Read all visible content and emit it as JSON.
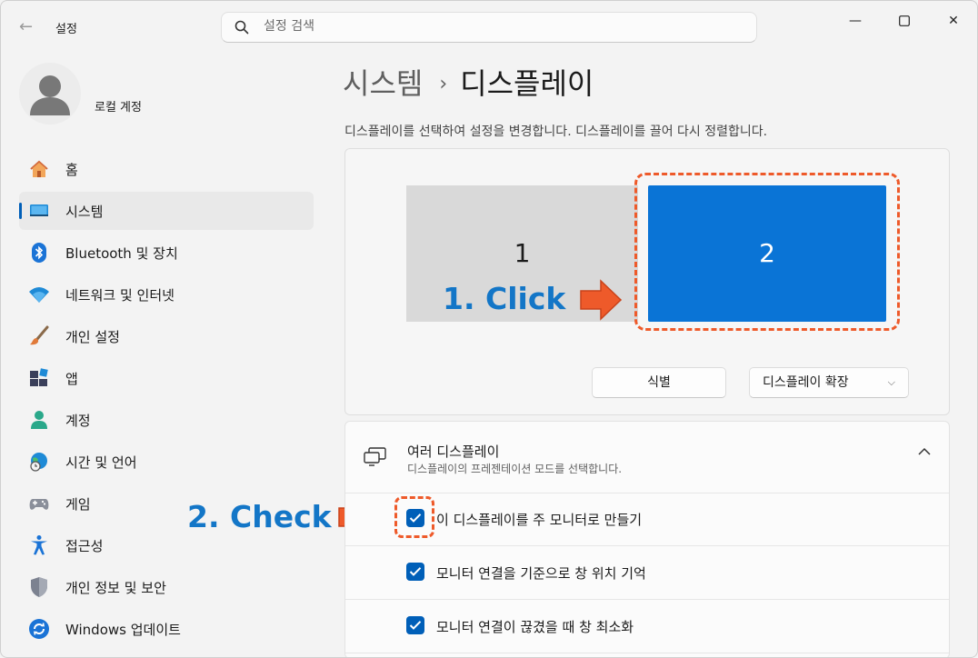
{
  "window": {
    "app_title": "설정",
    "search_placeholder": "설정 검색",
    "back_glyph": "←",
    "minimize_glyph": "—",
    "maximize_glyph": "☐",
    "close_glyph": "✕"
  },
  "profile": {
    "name": "로컬 계정"
  },
  "sidebar": {
    "items": [
      {
        "label": "홈",
        "icon": "home-icon"
      },
      {
        "label": "시스템",
        "icon": "system-icon",
        "active": true
      },
      {
        "label": "Bluetooth 및 장치",
        "icon": "bluetooth-icon"
      },
      {
        "label": "네트워크 및 인터넷",
        "icon": "wifi-icon"
      },
      {
        "label": "개인 설정",
        "icon": "brush-icon"
      },
      {
        "label": "앱",
        "icon": "apps-icon"
      },
      {
        "label": "계정",
        "icon": "account-icon"
      },
      {
        "label": "시간 및 언어",
        "icon": "globe-clock-icon"
      },
      {
        "label": "게임",
        "icon": "gamepad-icon"
      },
      {
        "label": "접근성",
        "icon": "accessibility-icon"
      },
      {
        "label": "개인 정보 및 보안",
        "icon": "shield-icon"
      },
      {
        "label": "Windows 업데이트",
        "icon": "update-icon"
      }
    ]
  },
  "breadcrumb": {
    "parent": "시스템",
    "separator": "›",
    "current": "디스플레이"
  },
  "arrangement": {
    "description": "디스플레이를 선택하여 설정을 변경합니다. 디스플레이를 끌어 다시 정렬합니다.",
    "monitor_1": "1",
    "monitor_2": "2",
    "identify_label": "식별",
    "mode_label": "디스플레이 확장",
    "mode_chevron": "⌵"
  },
  "annotations": {
    "step1": "1. Click",
    "step2": "2. Check"
  },
  "multi_display": {
    "title": "여러 디스플레이",
    "subtitle": "디스플레이의 프레젠테이션 모드를 선택합니다.",
    "collapse_glyph": "︿",
    "options": [
      {
        "label": "이 디스플레이를 주 모니터로 만들기",
        "checked": true
      },
      {
        "label": "모니터 연결을 기준으로 창 위치 기억",
        "checked": true
      },
      {
        "label": "모니터 연결이 끊겼을 때 창 최소화",
        "checked": true
      }
    ]
  },
  "colors": {
    "accent": "#005fb8",
    "monitor_selected": "#0a74d6",
    "annotation_text": "#1376c7",
    "annotation_arrow": "#ee5a2a"
  }
}
